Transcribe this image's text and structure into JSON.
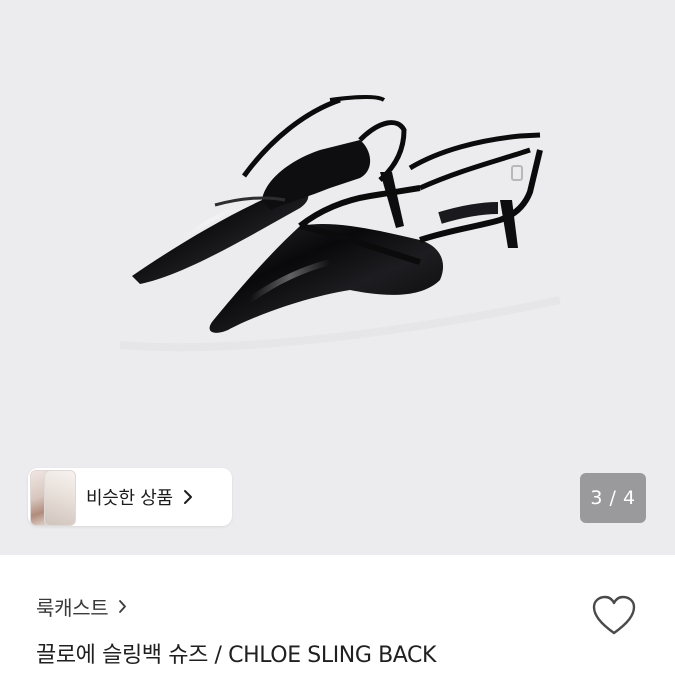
{
  "similar_products": {
    "label": "비슷한 상품"
  },
  "pager": {
    "text": "3 / 4",
    "current": 3,
    "total": 4
  },
  "product": {
    "brand": "룩캐스트",
    "title": "끌로에 슬링백 슈즈 / CHLOE SLING BACK"
  },
  "icons": {
    "similar_chevron": "chevron-right-icon",
    "brand_chevron": "chevron-right-icon",
    "like": "heart-outline-icon"
  },
  "colors": {
    "hero_bg": "#ececee",
    "pager_bg": "#9a9a9c",
    "shoe": "#0d0d0f"
  }
}
